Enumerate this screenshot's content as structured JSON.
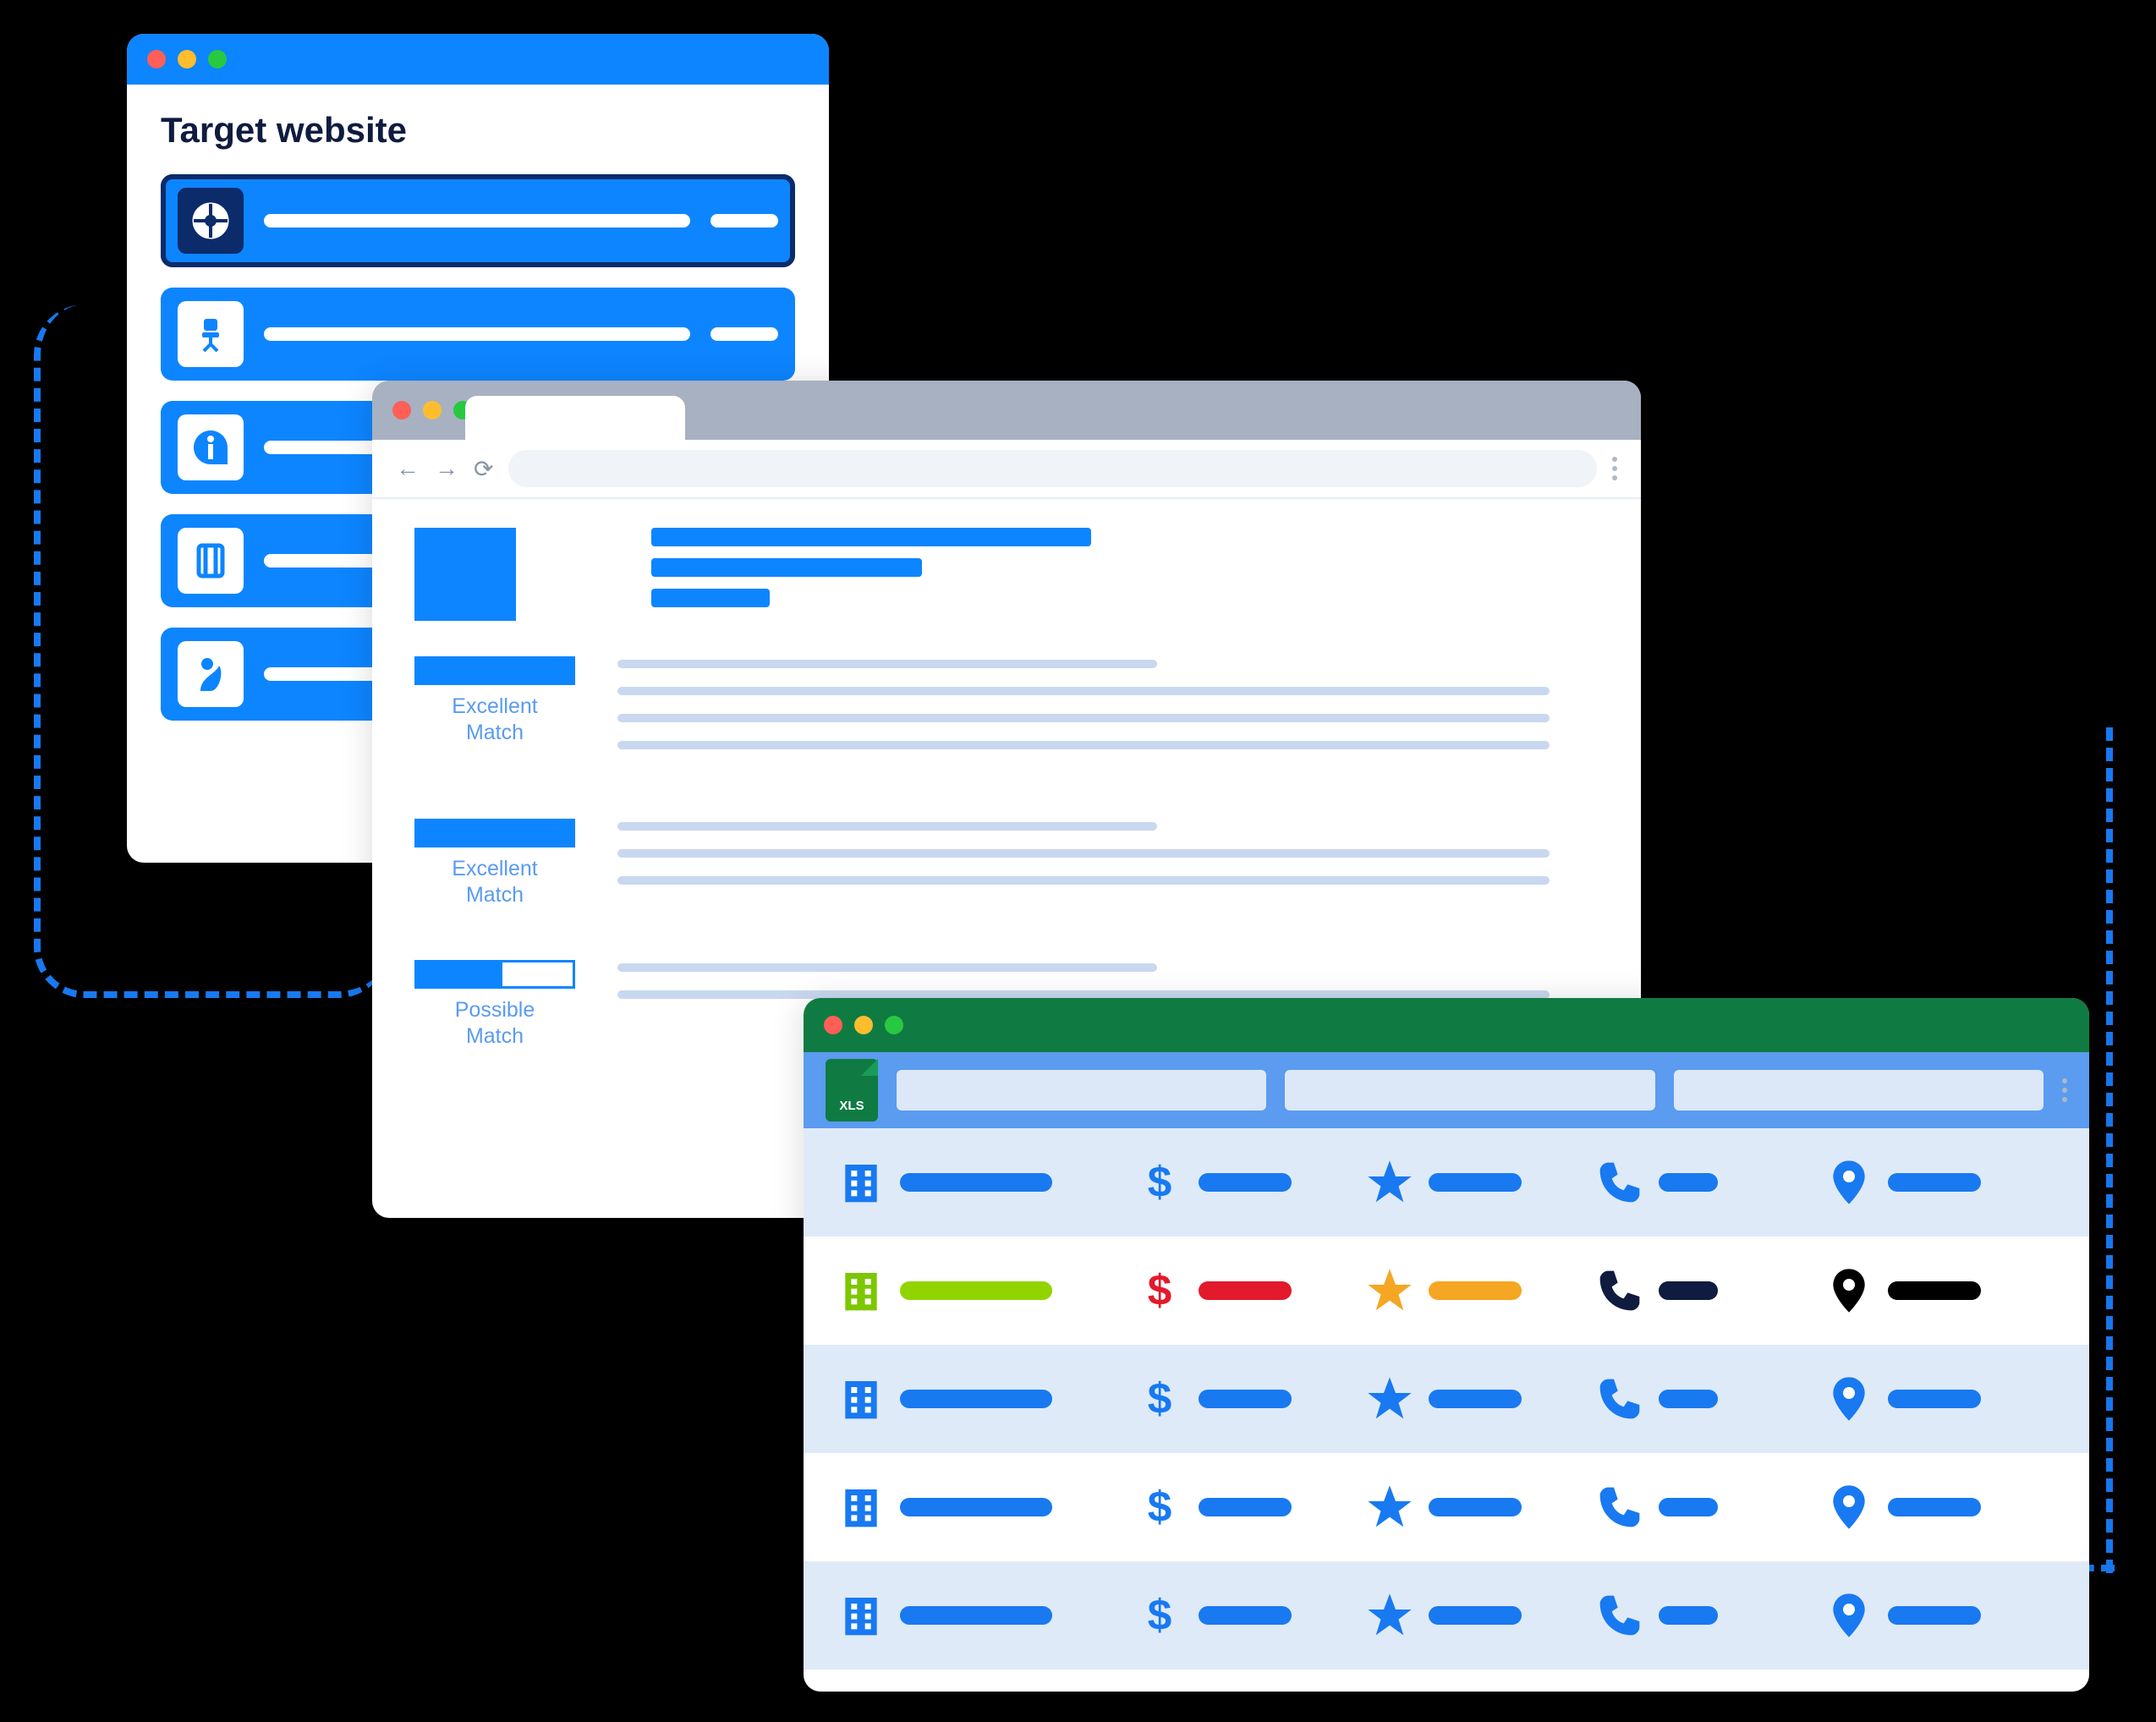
{
  "windows": {
    "target": {
      "title": "Target website",
      "rows": [
        {
          "icon": "logo-a",
          "selected": true
        },
        {
          "icon": "chair-icon",
          "selected": false
        },
        {
          "icon": "info-icon",
          "selected": false
        },
        {
          "icon": "door-icon",
          "selected": false
        },
        {
          "icon": "person-icon",
          "selected": false
        }
      ]
    },
    "browser": {
      "matches": [
        {
          "label_line1": "Excellent",
          "label_line2": "Match",
          "fill_pct": 100
        },
        {
          "label_line1": "Excellent",
          "label_line2": "Match",
          "fill_pct": 100
        },
        {
          "label_line1": "Possible",
          "label_line2": "Match",
          "fill_pct": 55
        }
      ]
    },
    "spreadsheet": {
      "xls_label": "XLS",
      "rows": [
        {
          "color": "#1879f1",
          "alt": true,
          "highlight": false
        },
        {
          "color": "#1879f1",
          "alt": false,
          "highlight": true,
          "mix": {
            "building": "#7cc700",
            "text1": "#92d400",
            "dollar": "#e21a2c",
            "star": "#f5a623",
            "startxt": "#f5a623",
            "phone": "#0f1c3f",
            "pin": "#000"
          }
        },
        {
          "color": "#1879f1",
          "alt": true,
          "highlight": false
        },
        {
          "color": "#1879f1",
          "alt": false,
          "highlight": false
        },
        {
          "color": "#1879f1",
          "alt": true,
          "highlight": false
        }
      ]
    }
  }
}
